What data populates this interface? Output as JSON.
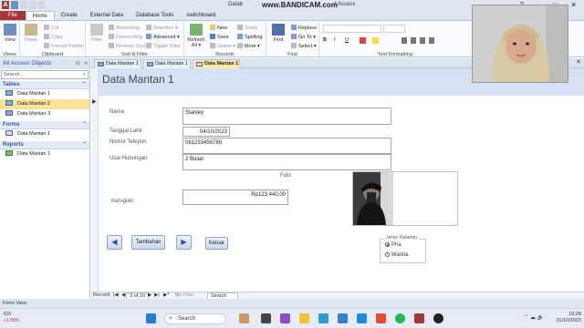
{
  "titlebar": {
    "title_left": "Datab",
    "watermark": "www.BANDICAM.com",
    "title_right": "t Access",
    "buttons": [
      "?",
      "–",
      "□",
      "✕"
    ]
  },
  "ribbon_tabs": [
    "File",
    "Home",
    "Create",
    "External Data",
    "Database Tools",
    "switchboard"
  ],
  "ribbon": {
    "views": {
      "view_label": "View",
      "group": "Views"
    },
    "clipboard": {
      "paste": "Paste",
      "cut": "Cut",
      "copy": "Copy",
      "format_painter": "Format Painter",
      "group": "Clipboard"
    },
    "sort_filter": {
      "filter": "Filter",
      "ascending": "Ascending",
      "descending": "Descending",
      "remove_sort": "Remove Sort",
      "selection": "Selection ▾",
      "advanced": "Advanced ▾",
      "toggle_filter": "Toggle Filter",
      "group": "Sort & Filter"
    },
    "records": {
      "refresh": "Refresh All ▾",
      "new": "New",
      "save": "Save",
      "delete": "Delete ▾",
      "totals": "Totals",
      "spelling": "Spelling",
      "more": "More ▾",
      "group": "Records"
    },
    "find": {
      "find": "Find",
      "replace": "Replace",
      "goto": "Go To ▾",
      "select": "Select ▾",
      "group": "Find"
    },
    "text_formatting": {
      "bold": "B",
      "italic": "I",
      "underline": "U",
      "group": "Text Formatting"
    }
  },
  "nav": {
    "header": "All Access Objects",
    "search_placeholder": "Search...",
    "sections": [
      {
        "title": "Tables",
        "items": [
          "Data Mantan 1",
          "Data Mantan 2",
          "Data Mantan 3"
        ]
      },
      {
        "title": "Forms",
        "items": [
          "Data Mantan 1"
        ]
      },
      {
        "title": "Reports",
        "items": [
          "Data Mantan 1"
        ]
      }
    ]
  },
  "doc_tabs": [
    "Data Mantan 1",
    "Data Mantan 1",
    "Data Mantan 1"
  ],
  "form": {
    "title": "Data Mantan 1",
    "labels": {
      "nama": "Nama",
      "tanggal_lahir": "Tanggal Lahir",
      "nomor_telepon": "Nomor Telepon",
      "usia_hubungan": "Usia Hubungan",
      "foto": "Foto",
      "kerugian": "Kerugian"
    },
    "values": {
      "nama": "Stanley",
      "tanggal_lahir": "04/10/2023",
      "nomor_telepon": "081233456789",
      "usia_hubungan": "2 Bulan",
      "kerugian": "Rp123.440,00"
    },
    "buttons": {
      "prev": "◀",
      "tambahan": "Tambahan",
      "next": "▶",
      "keluar": "Keluar"
    },
    "jenis_kelamin": {
      "title": "Jenis Kelamin",
      "options": [
        "Pria",
        "Wanita"
      ],
      "selected": "Pria"
    }
  },
  "record_nav": {
    "label": "Record:",
    "nav_first": "|◀",
    "nav_prev": "◀",
    "position": "3 of 10",
    "nav_next": "▶",
    "nav_last": "▶|",
    "nav_new": "▶*",
    "filter": "No Filter",
    "search": "Search"
  },
  "status_bar": {
    "text": "Form View"
  },
  "taskbar": {
    "weather_line1": "IDX",
    "weather_line2": "+1.58%",
    "search_label": "Search",
    "time": "19:28",
    "date": "31/10/2023"
  }
}
